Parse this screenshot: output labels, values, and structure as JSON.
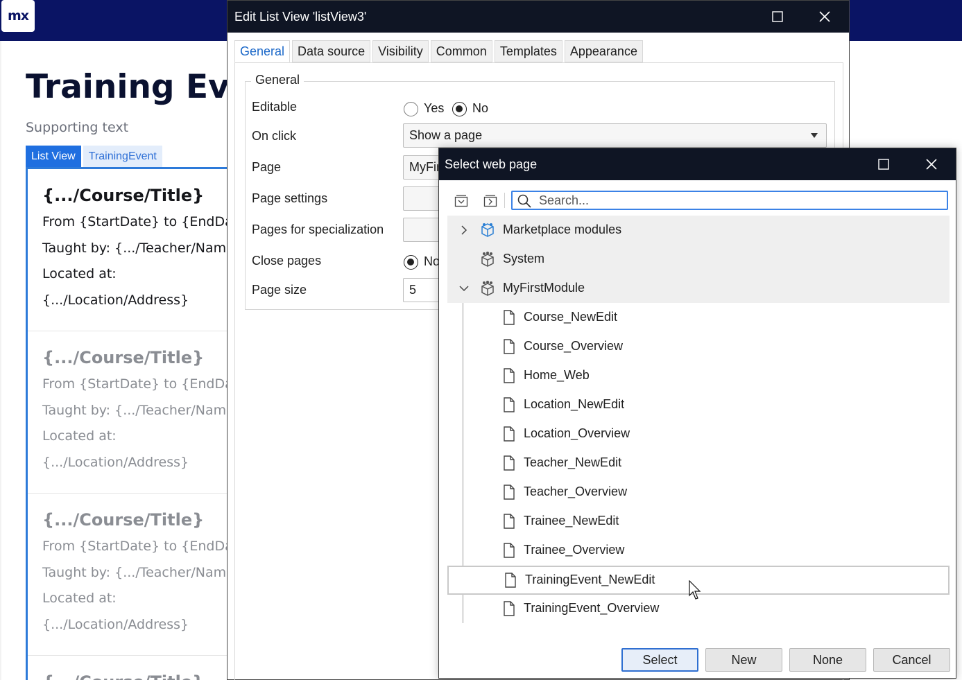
{
  "app": {
    "logo_text": "mx"
  },
  "page": {
    "title": "Training Eve",
    "supporting_text": "Supporting text",
    "tabs": [
      "List View",
      "TrainingEvent"
    ],
    "list_items": [
      {
        "title": "{.../Course/Title}",
        "lines": [
          "From {StartDate} to {EndDa",
          "Taught by: {.../Teacher/Nam",
          "Located at:",
          "{.../Location/Address}"
        ]
      },
      {
        "title": "{.../Course/Title}",
        "lines": [
          "From {StartDate} to {EndDa",
          "Taught by: {.../Teacher/Nam",
          "Located at:",
          "{.../Location/Address}"
        ]
      },
      {
        "title": "{.../Course/Title}",
        "lines": [
          "From {StartDate} to {EndDa",
          "Taught by: {.../Teacher/Nam",
          "Located at:",
          "{.../Location/Address}"
        ]
      },
      {
        "title": "{.../Course/Title}"
      }
    ]
  },
  "edit_dialog": {
    "title": "Edit List View 'listView3'",
    "tabs": [
      "General",
      "Data source",
      "Visibility",
      "Common",
      "Templates",
      "Appearance"
    ],
    "active_tab": "General",
    "group_title": "General",
    "fields": {
      "editable": {
        "label": "Editable",
        "options": [
          "Yes",
          "No"
        ],
        "selected": "No"
      },
      "on_click": {
        "label": "On click",
        "value": "Show a page"
      },
      "page": {
        "label": "Page",
        "value": "MyFir"
      },
      "page_settings": {
        "label": "Page settings",
        "value": ""
      },
      "pages_for_specialization": {
        "label": "Pages for specialization",
        "value": ""
      },
      "close_pages": {
        "label": "Close pages",
        "option": "No",
        "selected": true
      },
      "page_size": {
        "label": "Page size",
        "value": "5"
      }
    }
  },
  "select_dialog": {
    "title": "Select web page",
    "search_placeholder": "Search...",
    "tree": [
      {
        "label": "Marketplace modules",
        "expanded": false,
        "icon": "module-icon"
      },
      {
        "label": "System",
        "icon": "system-module-icon"
      },
      {
        "label": "MyFirstModule",
        "expanded": true,
        "icon": "module-icon"
      }
    ],
    "pages": [
      "Course_NewEdit",
      "Course_Overview",
      "Home_Web",
      "Location_NewEdit",
      "Location_Overview",
      "Teacher_NewEdit",
      "Teacher_Overview",
      "Trainee_NewEdit",
      "Trainee_Overview",
      "TrainingEvent_NewEdit",
      "TrainingEvent_Overview"
    ],
    "hovered_page": "TrainingEvent_NewEdit",
    "buttons": {
      "select": "Select",
      "new": "New",
      "none": "None",
      "cancel": "Cancel"
    }
  },
  "colors": {
    "topbar": "#0a1464",
    "accent": "#1f6fe0",
    "titlebar": "#0f1524"
  }
}
